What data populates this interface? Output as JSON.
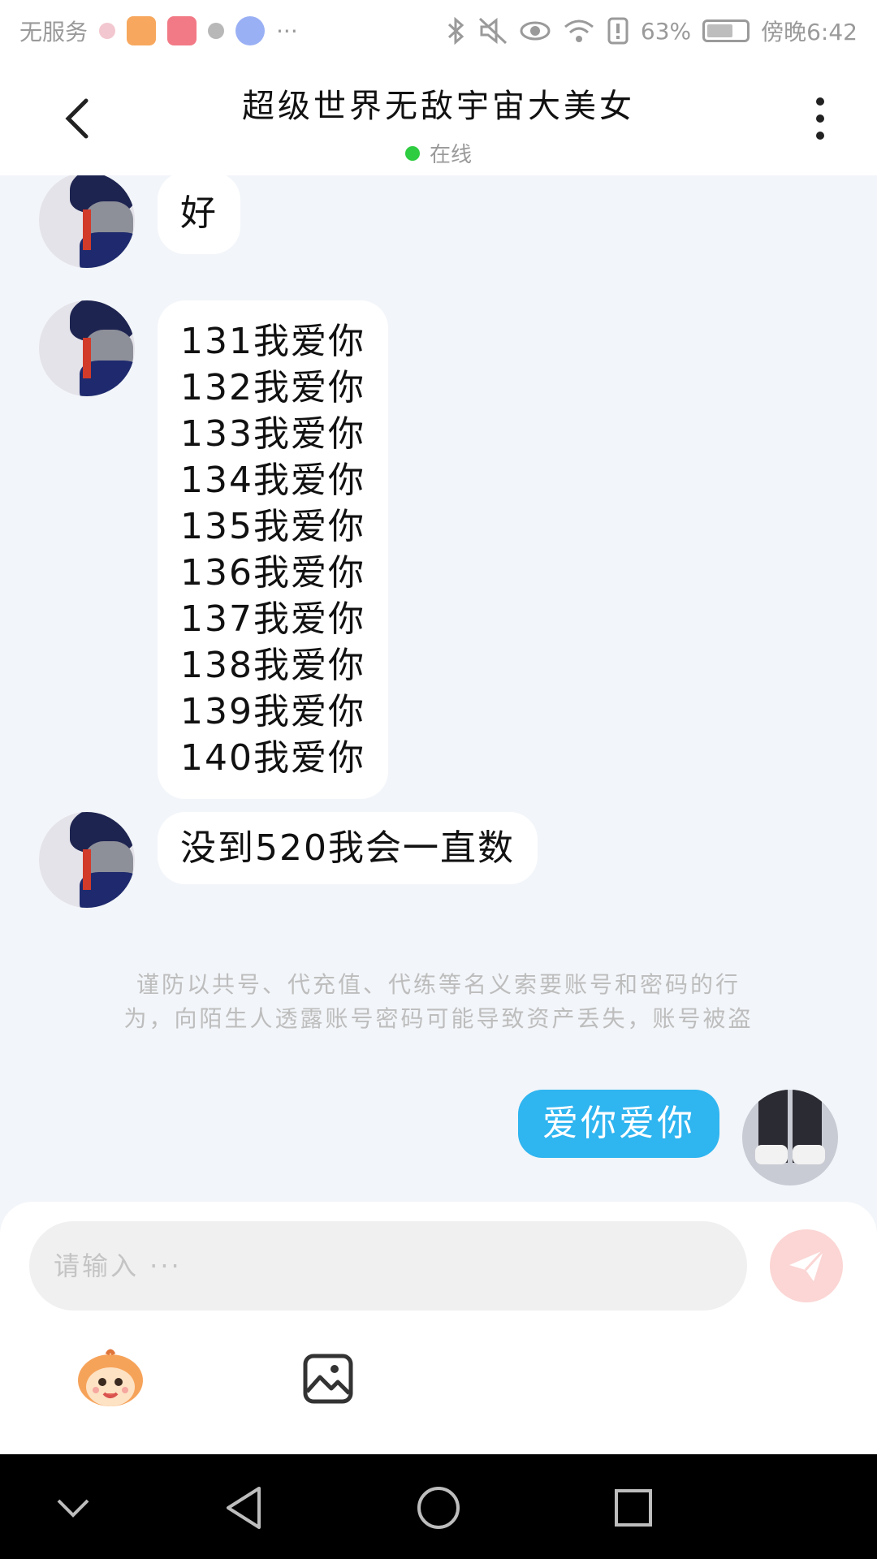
{
  "status_bar": {
    "carrier": "无服务",
    "battery": "63%",
    "time": "傍晚6:42"
  },
  "header": {
    "title": "超级世界无敌宇宙大美女",
    "status": "在线"
  },
  "messages": [
    {
      "lines": [
        "好"
      ]
    },
    {
      "lines": [
        "131我爱你",
        "132我爱你",
        "133我爱你",
        "134我爱你",
        "135我爱你",
        "136我爱你",
        "137我爱你",
        "138我爱你",
        "139我爱你",
        "140我爱你"
      ]
    },
    {
      "lines": [
        "没到520我会一直数"
      ]
    }
  ],
  "notice": {
    "line1": "谨防以共号、代充值、代练等名义索要账号和密码的行",
    "line2": "为，向陌生人透露账号密码可能导致资产丢失，账号被盗"
  },
  "my_message": "爱你爱你",
  "composer": {
    "placeholder": "请输入 ···"
  },
  "colors": {
    "accent": "#2fb5f0",
    "online": "#2ecc40",
    "send_disabled": "#fbd6d4"
  },
  "icons": [
    "back-icon",
    "more-icon",
    "send-icon",
    "emoji-icon",
    "image-icon",
    "nav-back-icon",
    "nav-home-icon",
    "nav-recents-icon",
    "nav-down-icon"
  ]
}
